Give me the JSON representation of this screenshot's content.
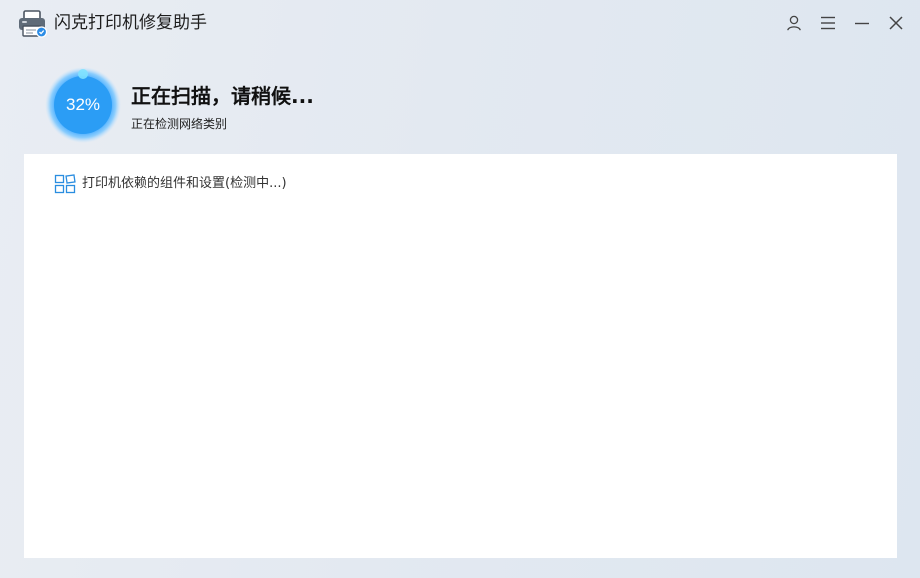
{
  "app": {
    "title": "闪克打印机修复助手",
    "icon": "printer-icon"
  },
  "window_controls": {
    "user": "user-icon",
    "menu": "menu-icon",
    "minimize": "minimize-icon",
    "close": "close-icon"
  },
  "scan": {
    "progress_percent": 32,
    "progress_label": "32%",
    "title": "正在扫描，请稍候...",
    "subtitle": "正在检测网络类别"
  },
  "items": [
    {
      "icon": "grid-icon",
      "label": "打印机依赖的组件和设置(检测中...)"
    }
  ],
  "colors": {
    "accent": "#2b9df5",
    "accent_light": "#5cc7ff",
    "icon_blue": "#2a8de0"
  }
}
